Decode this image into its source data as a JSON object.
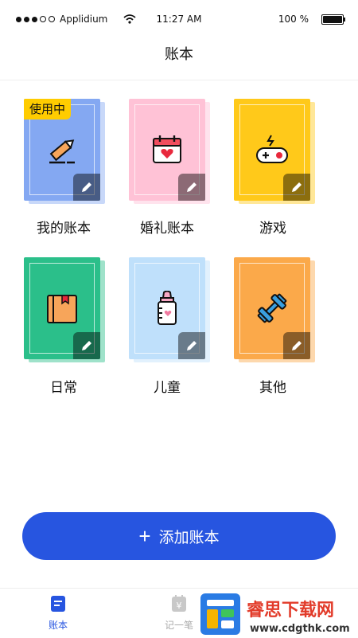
{
  "status_bar": {
    "carrier": "Applidium",
    "time": "11:27 AM",
    "battery": "100 %"
  },
  "header": {
    "title": "账本"
  },
  "books": [
    {
      "label": "我的账本",
      "icon": "pencil-icon",
      "color": "#84a8f2",
      "badge": "使用中"
    },
    {
      "label": "婚礼账本",
      "icon": "calendar-heart-icon",
      "color": "#ffc2d6"
    },
    {
      "label": "游戏",
      "icon": "gamepad-icon",
      "color": "#ffc91a"
    },
    {
      "label": "日常",
      "icon": "box-icon",
      "color": "#2bbf8a"
    },
    {
      "label": "儿童",
      "icon": "baby-bottle-icon",
      "color": "#bfe0fb"
    },
    {
      "label": "其他",
      "icon": "dumbbell-icon",
      "color": "#fba94a"
    }
  ],
  "add_button": {
    "label": "添加账本"
  },
  "tabbar": {
    "tabs": [
      {
        "label": "账本"
      },
      {
        "label": "记一笔"
      }
    ]
  },
  "watermark": {
    "text": "睿思下载网",
    "url": "www.cdgthk.com"
  }
}
